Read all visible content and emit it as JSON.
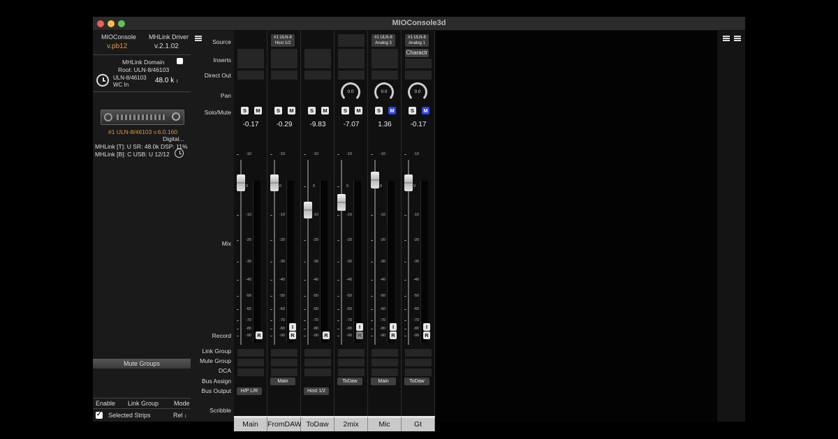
{
  "window": {
    "title": "MIOConsole3d"
  },
  "left_panel": {
    "console_label": "MIOConsole",
    "console_version": "v.pb12",
    "driver_label": "MHLink Driver",
    "driver_version": "v.2.1.02",
    "domain_label": "MHLink Domain",
    "root_label": "Root: ULN-8/46103",
    "clock_source_line1": "ULN-8/46103",
    "clock_source_line2": "WC In",
    "sample_rate": "48.0 k",
    "device_name": "#1 ULN-8/46103 v.6.0.160",
    "device_status": "Digital...",
    "mhlink_t": "MHLink [T]: U SR: 48.0k DSP: 11%",
    "mhlink_b": "MHLink [B]: C USB: U 12/12",
    "mute_groups_header": "Mute Groups",
    "col_enable": "Enable",
    "col_link_group": "Link Group",
    "col_mode": "Mode",
    "selected_strips_label": "Selected Strips",
    "selected_strips_mode": "Rel"
  },
  "row_labels": {
    "source": "Source",
    "inserts": "Inserts",
    "direct_out": "Direct Out",
    "pan": "Pan",
    "solo_mute": "Solo/Mute",
    "mix": "Mix",
    "record": "Record",
    "link_group": "Link Group",
    "mute_group": "Mute Group",
    "dca": "DCA",
    "bus_assign": "Bus Assign",
    "bus_output": "Bus Output",
    "scribble": "Scribble"
  },
  "button_labels": {
    "solo": "S",
    "mute": "M",
    "input": "I",
    "record": "R"
  },
  "scale_ticks": [
    "-10",
    "0",
    "-10",
    "-20",
    "-30",
    "-40",
    "-50",
    "-60",
    "-70",
    "-80",
    "-90"
  ],
  "strips": [
    {
      "scribble": "Main",
      "source_line1": "",
      "source_line2": "",
      "insert": "",
      "pan_value": "",
      "gain": "-0.17",
      "mute_on": false,
      "fader_level_db": -0.17,
      "bus_assign": "",
      "bus_output": "H/P L/R",
      "show_input_btn": false
    },
    {
      "scribble": "FromDAW",
      "source_line1": "#1 ULN-8",
      "source_line2": "Host 1/2",
      "insert": "",
      "pan_value": "",
      "gain": "-0.29",
      "mute_on": false,
      "fader_level_db": -0.29,
      "bus_assign": "Main",
      "bus_output": "",
      "show_input_btn": true
    },
    {
      "scribble": "ToDaw",
      "source_line1": "",
      "source_line2": "",
      "insert": "",
      "pan_value": "",
      "gain": "-9.83",
      "mute_on": false,
      "fader_level_db": -9.83,
      "bus_assign": "",
      "bus_output": "Host 1/2",
      "show_input_btn": false
    },
    {
      "scribble": "2mix",
      "source_line1": "",
      "source_line2": "",
      "insert": "",
      "pan_value": "0.0",
      "gain": "-7.07",
      "mute_on": false,
      "fader_level_db": -7.07,
      "bus_assign": "ToDaw",
      "bus_output": "",
      "show_input_btn": true
    },
    {
      "scribble": "Mic",
      "source_line1": "#1 ULN-8",
      "source_line2": "Analog 3",
      "insert": "",
      "pan_value": "0.0",
      "gain": "1.36",
      "mute_on": true,
      "fader_level_db": 1.36,
      "bus_assign": "Main",
      "bus_output": "",
      "show_input_btn": true
    },
    {
      "scribble": "Gt",
      "source_line1": "#1 ULN-8",
      "source_line2": "Analog 1",
      "insert": "Charactr",
      "pan_value": "0.0",
      "gain": "-0.17",
      "mute_on": true,
      "fader_level_db": -0.17,
      "bus_assign": "ToDaw",
      "bus_output": "",
      "show_input_btn": true
    }
  ],
  "colors": {
    "mute_active": "#2d46e6",
    "accent_orange": "#e8983a",
    "window_bg": "#141414"
  }
}
